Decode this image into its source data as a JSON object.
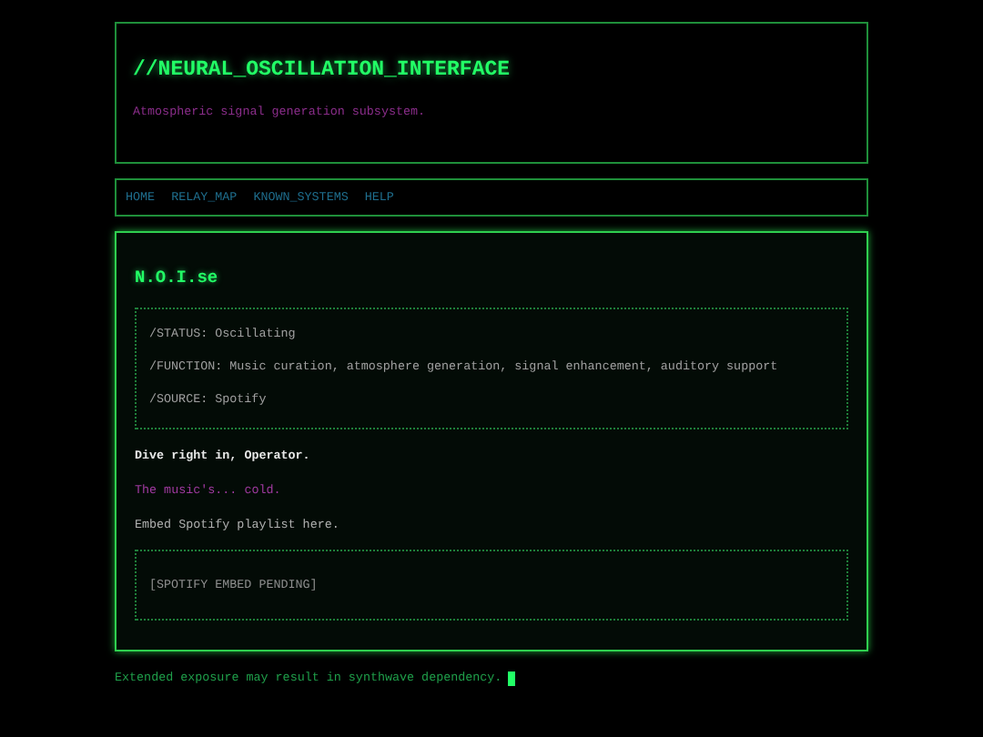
{
  "header": {
    "title": "//NEURAL_OSCILLATION_INTERFACE",
    "subtitle": "Atmospheric signal generation subsystem."
  },
  "nav": [
    {
      "label": "HOME"
    },
    {
      "label": "RELAY_MAP"
    },
    {
      "label": "KNOWN_SYSTEMS"
    },
    {
      "label": "HELP"
    }
  ],
  "card": {
    "title": "N.O.I.se",
    "info": [
      "/STATUS: Oscillating",
      "/FUNCTION: Music curation, atmosphere generation, signal enhancement, auditory support",
      "/SOURCE: Spotify"
    ],
    "paragraphs": [
      {
        "kind": "bold",
        "text": "Dive right in, Operator."
      },
      {
        "kind": "accent",
        "text": "The music's... cold."
      },
      {
        "kind": "plain",
        "text": "Embed Spotify playlist here."
      }
    ],
    "embed": "[SPOTIFY EMBED PENDING]"
  },
  "footer": {
    "text": "Extended exposure may result in synthwave dependency.",
    "cursor": true
  }
}
